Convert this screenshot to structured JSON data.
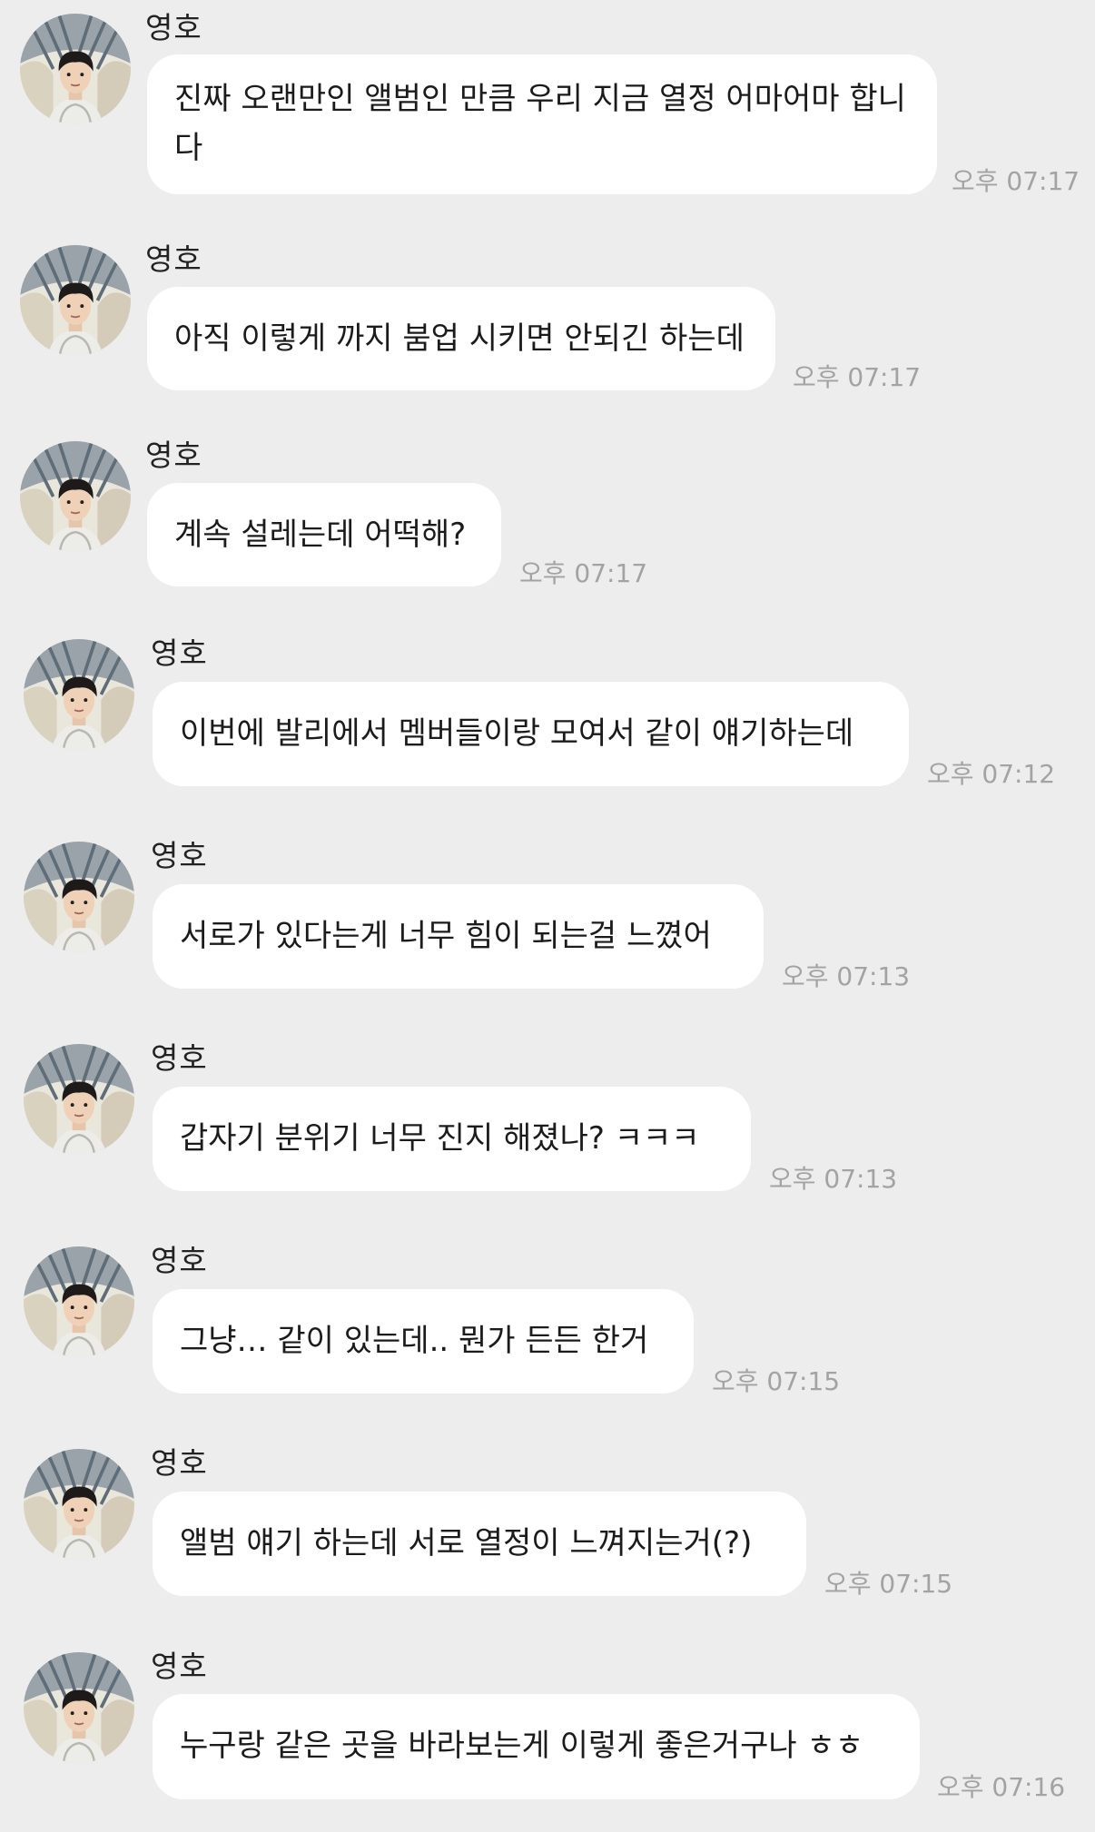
{
  "chat": {
    "sender_name": "영호",
    "messages": [
      {
        "text": "진짜 오랜만인 앨범인 만큼 우리 지금 열정 어마어마 합니다",
        "time": "오후 07:17"
      },
      {
        "text": "아직 이렇게 까지 붐업 시키면 안되긴 하는데",
        "time": "오후 07:17"
      },
      {
        "text": "계속 설레는데 어떡해?",
        "time": "오후 07:17"
      },
      {
        "text": "이번에 발리에서 멤버들이랑 모여서 같이 얘기하는데",
        "time": "오후 07:12"
      },
      {
        "text": "서로가 있다는게 너무 힘이 되는걸 느꼈어",
        "time": "오후 07:13"
      },
      {
        "text": "갑자기 분위기 너무 진지 해졌나? ㅋㅋㅋ",
        "time": "오후 07:13"
      },
      {
        "text": "그냥… 같이 있는데.. 뭔가 든든 한거",
        "time": "오후 07:15"
      },
      {
        "text": "앨범 얘기 하는데 서로 열정이 느껴지는거(?)",
        "time": "오후 07:15"
      },
      {
        "text": "누구랑 같은 곳을 바라보는게 이렇게 좋은거구나 ㅎㅎ",
        "time": "오후 07:16"
      }
    ]
  },
  "colors": {
    "background": "#ededed",
    "bubble": "#ffffff",
    "text": "#1b1b1b",
    "time": "#a3a3a3"
  },
  "icons": {
    "avatar": "profile-photo"
  }
}
